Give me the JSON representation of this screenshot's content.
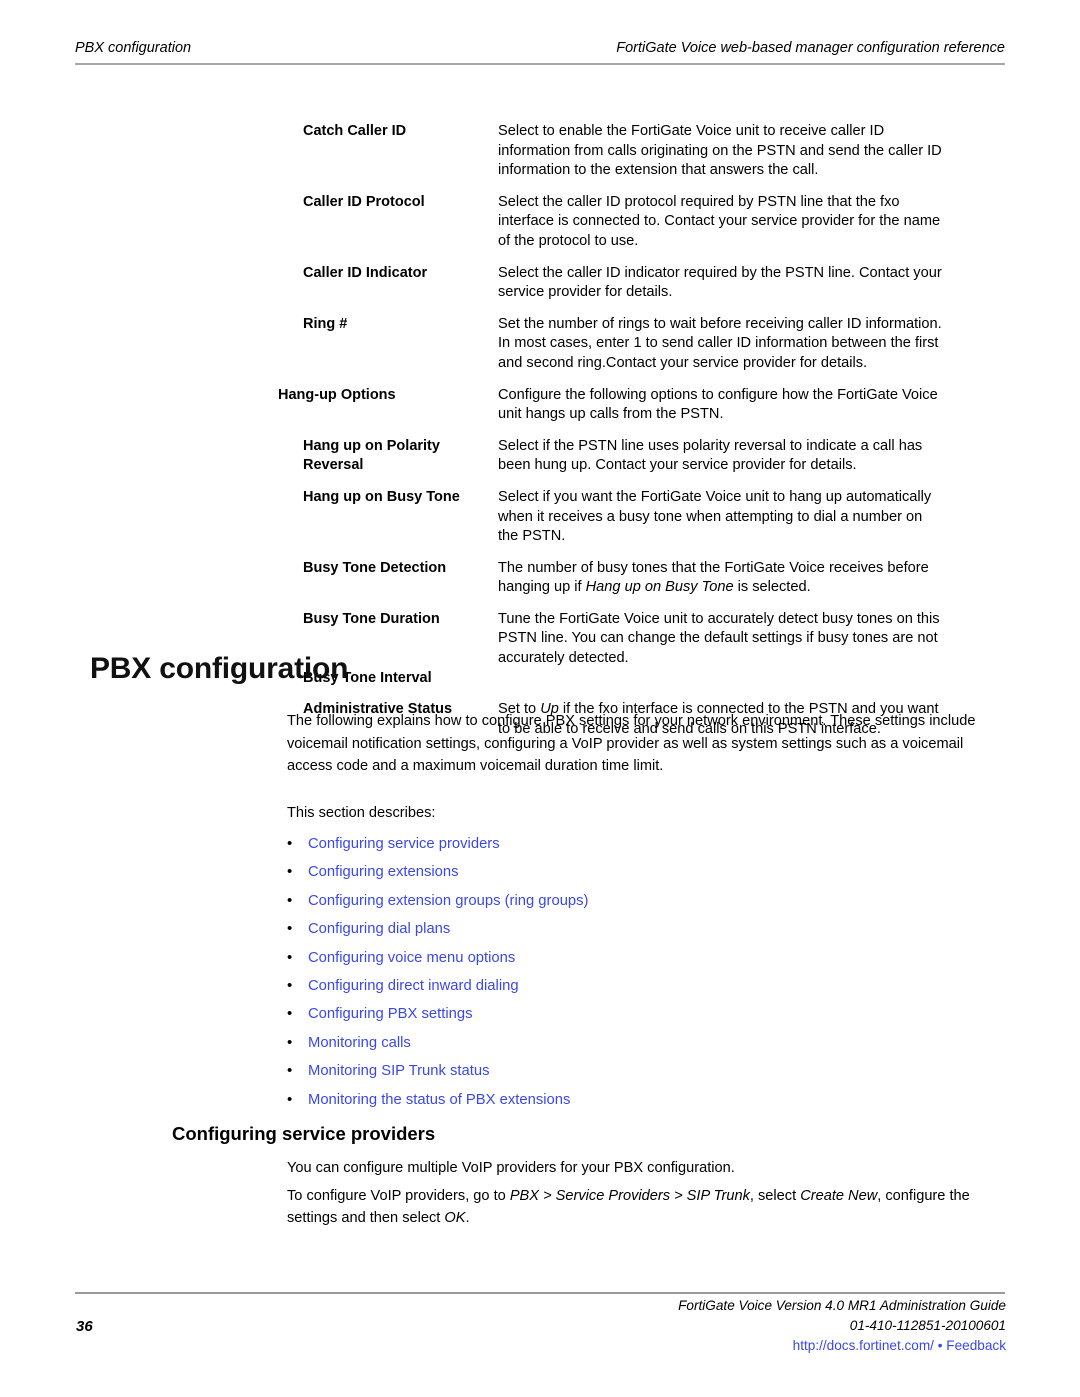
{
  "header": {
    "left": "PBX configuration",
    "right": "FortiGate Voice web-based manager configuration reference"
  },
  "definition_table": {
    "rows": [
      {
        "term": "Catch Caller ID",
        "description": "Select to enable the FortiGate Voice unit to receive caller ID information from calls originating on the PSTN and send the caller ID information to the extension that answers the call."
      },
      {
        "term": "Caller ID Protocol",
        "description": "Select the caller ID protocol required by PSTN line that the fxo interface is connected to. Contact your service provider for the name of the protocol to use."
      },
      {
        "term": "Caller ID Indicator",
        "description": "Select the caller ID indicator required by the PSTN line. Contact your service provider for details."
      },
      {
        "term": "Ring #",
        "description": "Set the number of rings to wait before receiving caller ID information. In most cases, enter 1 to send caller ID information between the first and second ring.Contact your service provider for details."
      },
      {
        "term": "Hang-up Options",
        "description": "Configure the following options to configure how the FortiGate Voice unit hangs up calls from the PSTN."
      },
      {
        "term": "Hang up on Polarity Reversal",
        "description": "Select if the PSTN line uses polarity reversal to indicate a call has been hung up. Contact your service provider for details."
      },
      {
        "term": "Hang up on Busy Tone",
        "description": "Select if you want the FortiGate Voice unit to hang up automatically when it receives a busy tone when attempting to dial a number on the PSTN."
      },
      {
        "term": "Busy Tone Detection",
        "description_pre": "The number of busy tones that the FortiGate Voice receives before hanging up if ",
        "description_em": "Hang up on Busy Tone",
        "description_post": " is selected."
      },
      {
        "term": "Busy Tone Duration",
        "description": "Tune the FortiGate Voice unit to accurately detect busy tones on this PSTN line. You can change the default settings if busy tones are not accurately detected."
      },
      {
        "term": "Busy Tone Interval",
        "description": ""
      },
      {
        "term": "Administrative Status",
        "description_pre": "Set to ",
        "description_em": "Up",
        "description_post": " if the fxo interface is connected to the PSTN and you want to be able to receive and send calls on this PSTN interface."
      }
    ]
  },
  "chapter": {
    "title": "PBX configuration",
    "intro": "The following explains how to configure PBX settings for your network environment. These settings include voicemail notification settings, configuring a VoIP provider as well as system settings such as a voicemail access code and a maximum voicemail duration time limit.",
    "section_describes": "This section describes:",
    "links": [
      "Configuring service providers",
      "Configuring extensions",
      "Configuring extension groups (ring groups)",
      "Configuring dial plans",
      "Configuring voice menu options",
      "Configuring direct inward dialing",
      "Configuring PBX settings",
      "Monitoring calls",
      "Monitoring SIP Trunk status",
      "Monitoring the status of PBX extensions"
    ],
    "bullet_glyph": "•"
  },
  "section": {
    "heading": "Configuring service providers",
    "paragraph_multi": "You can configure multiple VoIP providers for your PBX configuration.",
    "goto": {
      "pre": "To configure VoIP providers, go to ",
      "path": "PBX > Service Providers > SIP Trunk",
      "mid": ", select ",
      "create_new": "Create New",
      "mid2": ", configure the settings and then select ",
      "ok": "OK",
      "post": "."
    }
  },
  "footer": {
    "page_number": "36",
    "guide": "FortiGate Voice Version 4.0 MR1 Administration Guide",
    "doc_id": "01-410-112851-20100601",
    "url": "http://docs.fortinet.com/",
    "separator": "•",
    "feedback": "Feedback"
  },
  "colors": {
    "link_blue": "#3a48e8",
    "rule_gray": "#a8a8a8",
    "text_black": "#000000"
  }
}
